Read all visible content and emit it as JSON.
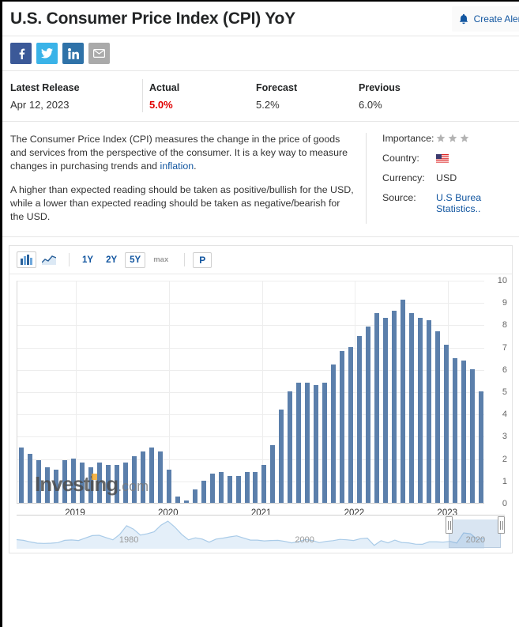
{
  "header": {
    "title": "U.S. Consumer Price Index (CPI) YoY",
    "alert_label": "Create Alert",
    "bell_icon": "bell-icon"
  },
  "social": [
    {
      "name": "facebook",
      "glyph": "f",
      "color": "#3b5998"
    },
    {
      "name": "twitter",
      "glyph": "t",
      "color": "#3ab3e8"
    },
    {
      "name": "linkedin",
      "glyph": "in",
      "color": "#2f72a8"
    },
    {
      "name": "email",
      "glyph": "mail",
      "color": "#aaaaaa"
    }
  ],
  "stats": {
    "latest_release_label": "Latest Release",
    "latest_release_value": "Apr 12, 2023",
    "actual_label": "Actual",
    "actual_value": "5.0%",
    "actual_color": "#e00000",
    "forecast_label": "Forecast",
    "forecast_value": "5.2%",
    "previous_label": "Previous",
    "previous_value": "6.0%"
  },
  "description": {
    "p1_a": "The Consumer Price Index (CPI) measures the change in the price of goods and services from the perspective of the consumer. It is a key way to measure changes in purchasing trends and ",
    "p1_link": "inflation",
    "p1_b": ".",
    "p2": "A higher than expected reading should be taken as positive/bullish for the USD, while a lower than expected reading should be taken as negative/bearish for the USD."
  },
  "meta": {
    "importance_label": "Importance:",
    "importance_stars": 3,
    "country_label": "Country:",
    "country_value": "United States",
    "currency_label": "Currency:",
    "currency_value": "USD",
    "source_label": "Source:",
    "source_line1": "U.S Burea",
    "source_line2": "Statistics.."
  },
  "toolbar": {
    "bar_icon": "bar-chart-icon",
    "line_icon": "line-chart-icon",
    "ranges": [
      {
        "label": "1Y",
        "selected": false
      },
      {
        "label": "2Y",
        "selected": false
      },
      {
        "label": "5Y",
        "selected": true
      },
      {
        "label": "max",
        "selected": false
      }
    ],
    "p_label": "P"
  },
  "watermark": {
    "brand": "Investing",
    "suffix": ".com"
  },
  "navigator": {
    "labels": [
      {
        "text": "1980",
        "pos": 23
      },
      {
        "text": "2000",
        "pos": 59
      },
      {
        "text": "2020",
        "pos": 94
      }
    ],
    "selection_start_pct": 88.5,
    "selection_end_pct": 99.2
  },
  "chart_data": {
    "type": "bar",
    "title": "U.S. Consumer Price Index (CPI) YoY",
    "xlabel": "",
    "ylabel": "",
    "ylim": [
      0,
      10
    ],
    "yticks": [
      0,
      1,
      2,
      3,
      4,
      5,
      6,
      7,
      8,
      9,
      10
    ],
    "xtick_labels": [
      "2019",
      "2020",
      "2021",
      "2022",
      "2023"
    ],
    "xtick_positions_pct": [
      12.5,
      32.4,
      52.3,
      72.2,
      92.1
    ],
    "grid": true,
    "legend": "none",
    "bar_color": "#5b7fab",
    "categories": [
      "2018-10",
      "2018-11",
      "2018-12",
      "2019-01",
      "2019-02",
      "2019-03",
      "2019-04",
      "2019-05",
      "2019-06",
      "2019-07",
      "2019-08",
      "2019-09",
      "2019-10",
      "2019-11",
      "2019-12",
      "2020-01",
      "2020-02",
      "2020-03",
      "2020-04",
      "2020-05",
      "2020-06",
      "2020-07",
      "2020-08",
      "2020-09",
      "2020-10",
      "2020-11",
      "2020-12",
      "2021-01",
      "2021-02",
      "2021-03",
      "2021-04",
      "2021-05",
      "2021-06",
      "2021-07",
      "2021-08",
      "2021-09",
      "2021-10",
      "2021-11",
      "2021-12",
      "2022-01",
      "2022-02",
      "2022-03",
      "2022-04",
      "2022-05",
      "2022-06",
      "2022-07",
      "2022-08",
      "2022-09",
      "2022-10",
      "2022-11",
      "2022-12",
      "2023-01",
      "2023-02",
      "2023-03"
    ],
    "values": [
      2.5,
      2.2,
      1.9,
      1.6,
      1.5,
      1.9,
      2.0,
      1.8,
      1.6,
      1.8,
      1.7,
      1.7,
      1.8,
      2.1,
      2.3,
      2.5,
      2.3,
      1.5,
      0.3,
      0.1,
      0.6,
      1.0,
      1.3,
      1.4,
      1.2,
      1.2,
      1.4,
      1.4,
      1.7,
      2.6,
      4.2,
      5.0,
      5.4,
      5.4,
      5.3,
      5.4,
      6.2,
      6.8,
      7.0,
      7.5,
      7.9,
      8.5,
      8.3,
      8.6,
      9.1,
      8.5,
      8.3,
      8.2,
      7.7,
      7.1,
      6.5,
      6.4,
      6.0,
      5.0
    ]
  }
}
